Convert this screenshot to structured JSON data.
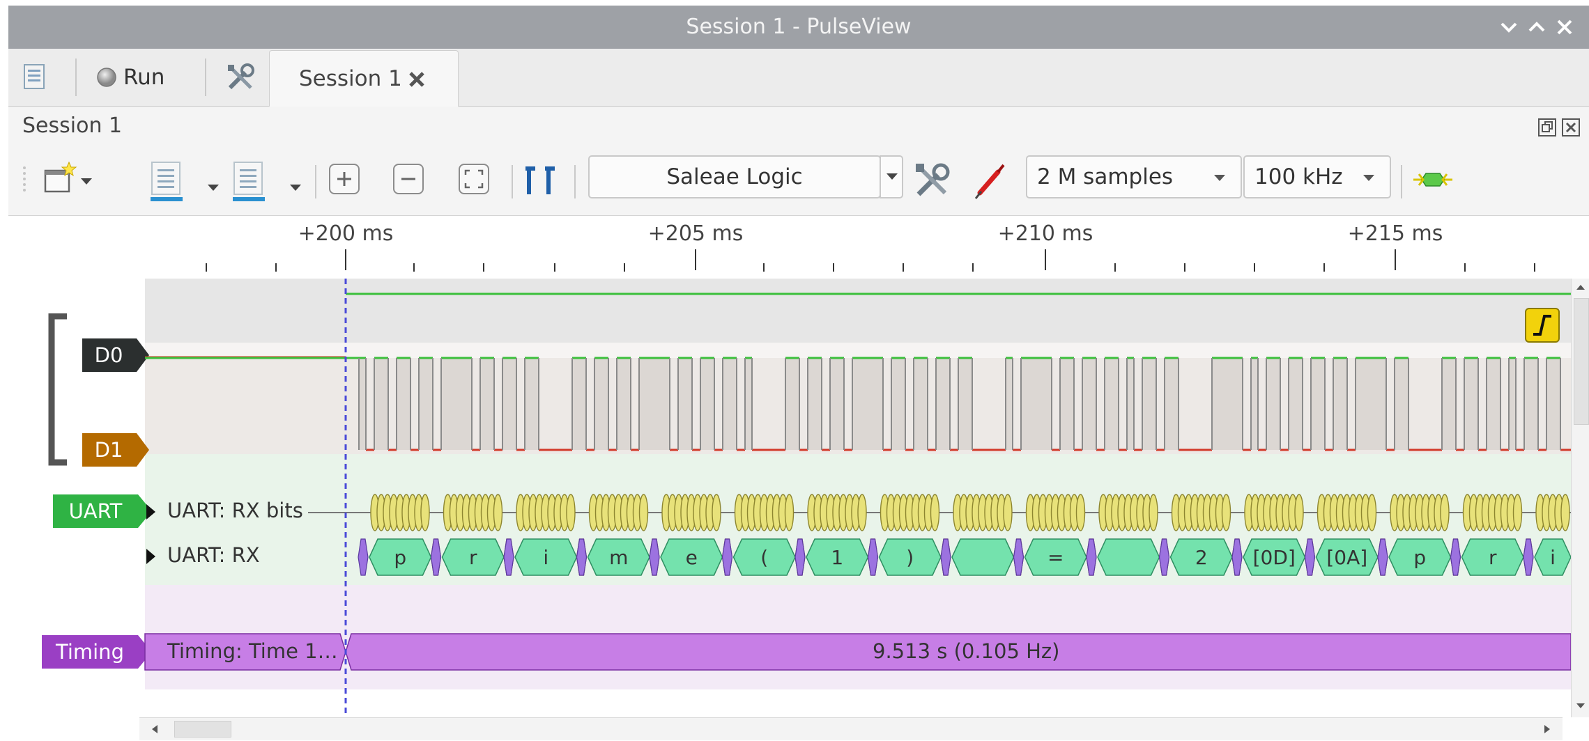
{
  "window": {
    "title": "Session 1 - PulseView"
  },
  "tabbar": {
    "run_label": "Run",
    "session_tab_label": "Session 1"
  },
  "dock": {
    "title": "Session 1"
  },
  "toolbar": {
    "device": "Saleae Logic",
    "samples": "2 M samples",
    "samplerate": "100 kHz"
  },
  "ruler": {
    "labels": [
      "+200 ms",
      "+205 ms",
      "+210 ms",
      "+215 ms"
    ]
  },
  "channels": {
    "d0": "D0",
    "d1": "D1"
  },
  "decoders": {
    "uart_chip": "UART",
    "rx_bits_label": "UART: RX bits",
    "rx_label": "UART: RX",
    "rx_data": [
      "p",
      "r",
      "i",
      "m",
      "e",
      "(",
      "1",
      ")",
      "",
      "=",
      "",
      "2",
      "[0D]",
      "[0A]",
      "p",
      "r",
      "i"
    ],
    "timing_chip": "Timing",
    "timing_label": "Timing: Time  1…",
    "timing_value": "9.513 s  (0.105 Hz)"
  },
  "colors": {
    "d0": "#2b2f2f",
    "d1": "#b46a00",
    "uart": "#2fb344",
    "timing": "#9a3fc4",
    "signal_high": "#3bbf3b",
    "signal_low": "#d23a2a",
    "bits_fill": "#e8e27a",
    "rx_fill": "#74e2ad",
    "timing_fill": "#c77ee6",
    "cursor": "#4a4ad8"
  }
}
